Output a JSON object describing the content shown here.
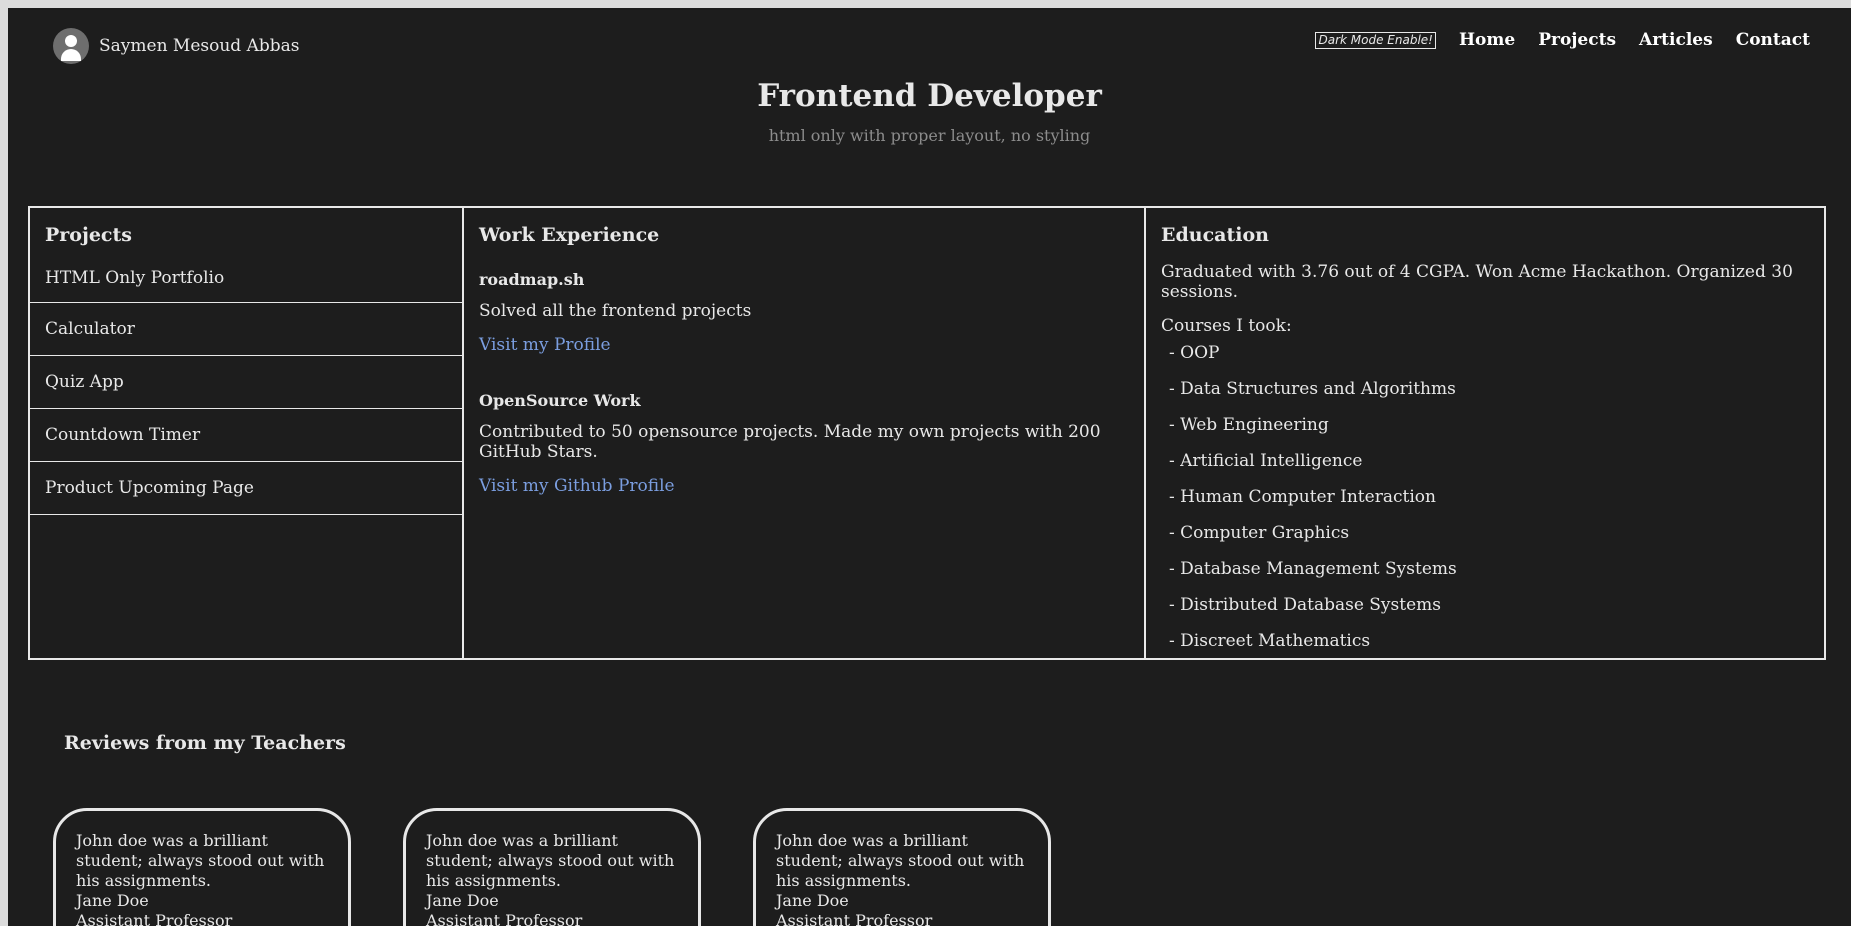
{
  "header": {
    "name": "Saymen Mesoud Abbas",
    "dark_mode_label": "Dark Mode Enable!",
    "nav": [
      "Home",
      "Projects",
      "Articles",
      "Contact"
    ]
  },
  "hero": {
    "title": "Frontend Developer",
    "subtitle": "html only with proper layout, no styling"
  },
  "projects": {
    "title": "Projects",
    "items": [
      "HTML Only Portfolio",
      "Calculator",
      "Quiz App",
      "Countdown Timer",
      "Product Upcoming Page"
    ]
  },
  "work": {
    "title": "Work Experience",
    "entries": [
      {
        "company": "roadmap.sh",
        "desc": "Solved all the frontend projects",
        "link": "Visit my Profile"
      },
      {
        "company": "OpenSource Work",
        "desc": "Contributed to 50 opensource projects. Made my own projects with 200 GitHub Stars.",
        "link": "Visit my Github Profile"
      }
    ]
  },
  "education": {
    "title": "Education",
    "summary": "Graduated with 3.76 out of 4 CGPA. Won Acme Hackathon. Organized 30 sessions.",
    "courses_label": "Courses I took:",
    "courses": [
      "- OOP",
      "- Data Structures and Algorithms",
      "- Web Engineering",
      "- Artificial Intelligence",
      "- Human Computer Interaction",
      "- Computer Graphics",
      "- Database Management Systems",
      "- Distributed Database Systems",
      "- Discreet Mathematics"
    ]
  },
  "reviews": {
    "title": "Reviews from my Teachers",
    "cards": [
      {
        "quote": "John doe was a brilliant student; always stood out with his assignments.",
        "author": "Jane Doe",
        "role": "Assistant Professor"
      },
      {
        "quote": "John doe was a brilliant student; always stood out with his assignments.",
        "author": "Jane Doe",
        "role": "Assistant Professor"
      },
      {
        "quote": "John doe was a brilliant student; always stood out with his assignments.",
        "author": "Jane Doe",
        "role": "Assistant Professor"
      }
    ]
  },
  "colors": {
    "background": "#1d1d1d",
    "text": "#e8e8e8",
    "link": "#7b9ee0",
    "muted": "#8c8c8c"
  }
}
